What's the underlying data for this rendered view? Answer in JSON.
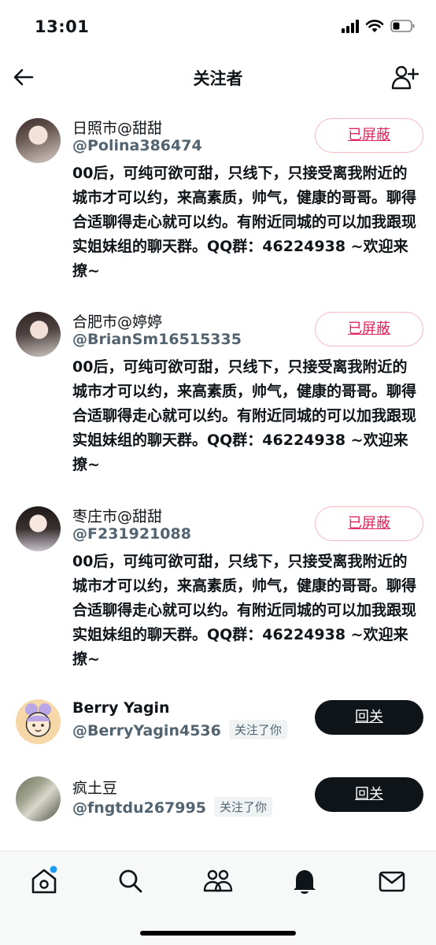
{
  "status_bar": {
    "time": "13:01"
  },
  "header": {
    "title": "关注者"
  },
  "followers": [
    {
      "name": "日照市@甜甜",
      "handle": "@Polina386474",
      "bio": "00后，可纯可欲可甜，只线下，只接受离我附近的城市才可以约，来高素质，帅气，健康的哥哥。聊得合适聊得走心就可以约。有附近同城的可以加我跟现实姐妹组的聊天群。QQ群：46224938 ~欢迎来撩~",
      "button": "已屏蔽"
    },
    {
      "name": "合肥市@婷婷",
      "handle": "@BrianSm16515335",
      "bio": "00后，可纯可欲可甜，只线下，只接受离我附近的城市才可以约，来高素质，帅气，健康的哥哥。聊得合适聊得走心就可以约。有附近同城的可以加我跟现实姐妹组的聊天群。QQ群：46224938 ~欢迎来撩~",
      "button": "已屏蔽"
    },
    {
      "name": "枣庄市@甜甜",
      "handle": "@F231921088",
      "bio": "00后，可纯可欲可甜，只线下，只接受离我附近的城市才可以约，来高素质，帅气，健康的哥哥。聊得合适聊得走心就可以约。有附近同城的可以加我跟现实姐妹组的聊天群。QQ群：46224938 ~欢迎来撩~",
      "button": "已屏蔽"
    },
    {
      "name": "Berry Yagin",
      "handle": "@BerryYagin4536",
      "badge": "关注了你",
      "button": "回关"
    },
    {
      "name": "疯土豆",
      "handle": "@fngtdu267995",
      "badge": "关注了你",
      "button": "回关"
    }
  ],
  "tabbar": {
    "items": [
      "home-icon",
      "search-icon",
      "communities-icon",
      "notifications-icon",
      "messages-icon"
    ]
  },
  "colors": {
    "blocked_text": "#e0245e",
    "follow_button_bg": "#0f1419",
    "handle_gray": "#536471",
    "notification_dot": "#1d9bf0"
  }
}
